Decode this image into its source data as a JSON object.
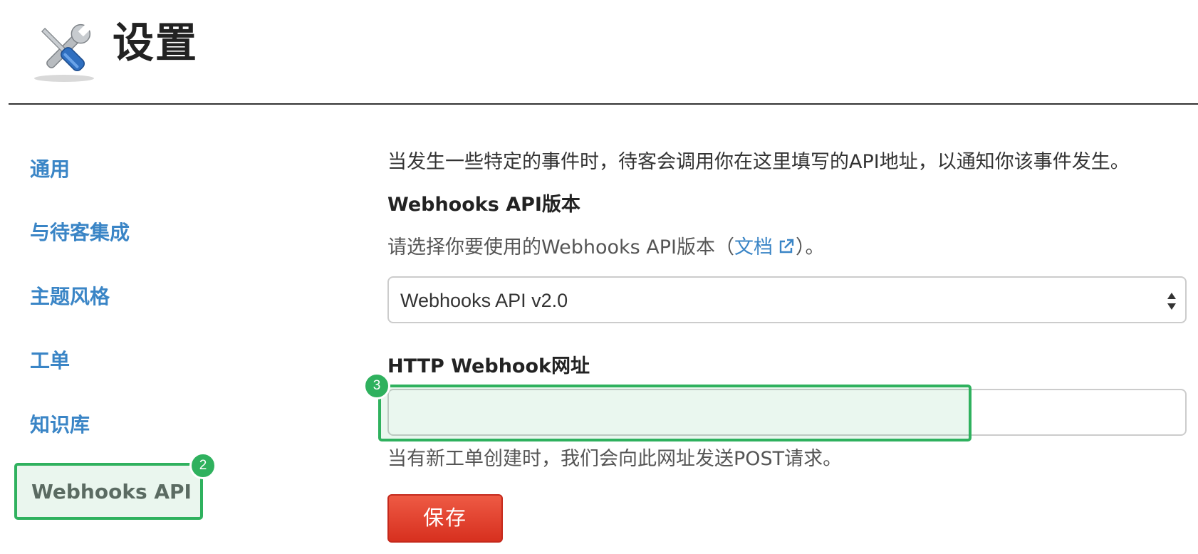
{
  "header": {
    "title": "设置",
    "icon": "tools-icon"
  },
  "sidebar": {
    "items": [
      {
        "label": "通用"
      },
      {
        "label": "与待客集成"
      },
      {
        "label": "主题风格"
      },
      {
        "label": "工单"
      },
      {
        "label": "知识库"
      },
      {
        "label": "Webhooks API"
      }
    ],
    "active_item": "Webhooks API",
    "active_marker": "2"
  },
  "main": {
    "intro": "当发生一些特定的事件时，待客会调用你在这里填写的API地址，以通知你该事件发生。",
    "version_section": {
      "label": "Webhooks API版本",
      "help_prefix": "请选择你要使用的Webhooks API版本（",
      "doc_link": "文档",
      "help_suffix": "）。",
      "selected_value": "Webhooks API v2.0"
    },
    "url_section": {
      "label": "HTTP Webhook网址",
      "value": "",
      "marker": "3",
      "help": "当有新工单创建时，我们会向此网址发送POST请求。"
    },
    "save_label": "保存"
  },
  "colors": {
    "link": "#3a85c6",
    "highlight": "#2fb15e",
    "save_button": "#d7301f"
  }
}
